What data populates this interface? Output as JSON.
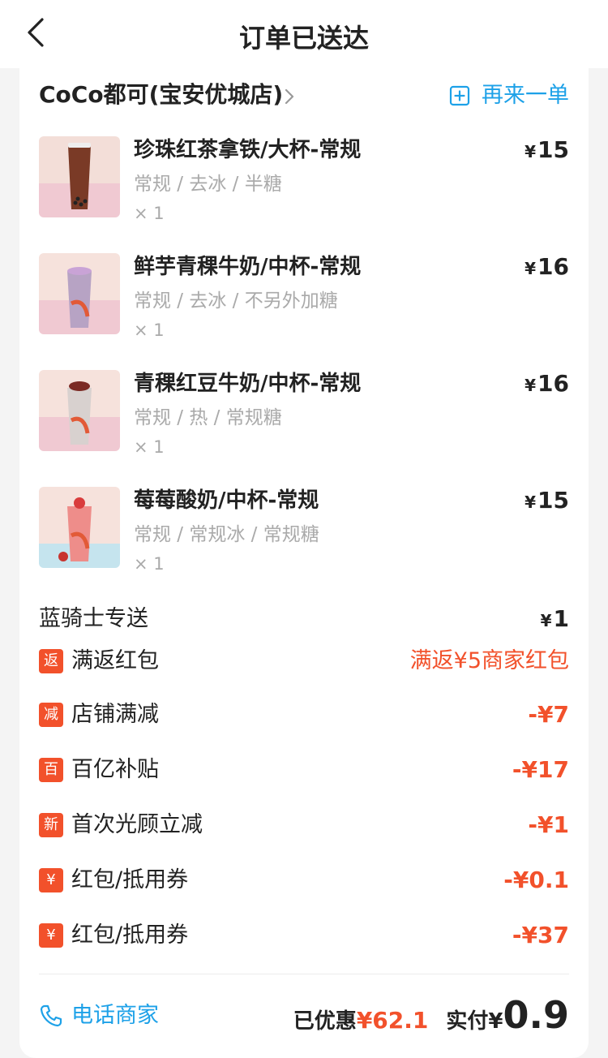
{
  "header": {
    "title": "订单已送达"
  },
  "store": {
    "name": "CoCo都可(宝安优城店)",
    "reorder_label": "再来一单"
  },
  "items": [
    {
      "name": "珍珠红茶拿铁/大杯-常规",
      "spec": "常规 / 去冰 / 半糖",
      "qty": "× 1",
      "price": "15",
      "bg_top": "#f3ded8",
      "bg_bottom": "#f0c9d2",
      "cup": "#7a3a26"
    },
    {
      "name": "鲜芋青稞牛奶/中杯-常规",
      "spec": "常规 / 去冰 / 不另外加糖",
      "qty": "× 1",
      "price": "16",
      "bg_top": "#f6e2dc",
      "bg_bottom": "#f0c9d2",
      "cup": "#b7a3c4"
    },
    {
      "name": "青稞红豆牛奶/中杯-常规",
      "spec": "常规 / 热 / 常规糖",
      "qty": "× 1",
      "price": "16",
      "bg_top": "#f6e2dc",
      "bg_bottom": "#f0c9d2",
      "cup": "#d8d1cf"
    },
    {
      "name": "莓莓酸奶/中杯-常规",
      "spec": "常规 / 常规冰 / 常规糖",
      "qty": "× 1",
      "price": "15",
      "bg_top": "#f6e2dc",
      "bg_bottom": "#c5e4ee",
      "cup": "#ee8d8a"
    }
  ],
  "delivery": {
    "label": "蓝骑士专送",
    "value": "1"
  },
  "discounts": [
    {
      "badge": "返",
      "label": "满返红包",
      "value": "满返¥5商家红包"
    },
    {
      "badge": "减",
      "label": "店铺满减",
      "value": "-¥7"
    },
    {
      "badge": "百",
      "label": "百亿补贴",
      "value": "-¥17"
    },
    {
      "badge": "新",
      "label": "首次光顾立减",
      "value": "-¥1"
    },
    {
      "badge": "¥",
      "label": "红包/抵用券",
      "value": "-¥0.1"
    },
    {
      "badge": "¥",
      "label": "红包/抵用券",
      "value": "-¥37"
    }
  ],
  "footer": {
    "call_label": "电话商家",
    "saved_label": "已优惠",
    "saved_value": "¥62.1",
    "paid_label": "实付",
    "paid_currency": "¥",
    "paid_value": "0.9"
  },
  "currency_symbol": "¥",
  "colors": {
    "accent_blue": "#1da1e8",
    "accent_red": "#f2512b"
  }
}
